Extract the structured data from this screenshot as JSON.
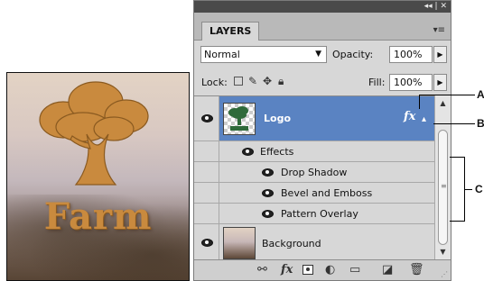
{
  "canvas_image": {
    "logo_text": "Farm"
  },
  "panel": {
    "title_controls": "◂◂ | ✕",
    "tab_label": "LAYERS",
    "tab_menu_icon": "▾≡",
    "blend_mode": "Normal",
    "opacity_label": "Opacity:",
    "opacity_value": "100%",
    "lock_label": "Lock:",
    "fill_label": "Fill:",
    "fill_value": "100%",
    "layers": [
      {
        "name": "Logo",
        "selected": true,
        "has_fx": true,
        "fx_symbol": "fx",
        "fx_arrow": "▴"
      },
      {
        "name": "Effects",
        "type": "effects-group"
      },
      {
        "name": "Drop Shadow",
        "type": "effect"
      },
      {
        "name": "Bevel and Emboss",
        "type": "effect"
      },
      {
        "name": "Pattern Overlay",
        "type": "effect"
      },
      {
        "name": "Background",
        "selected": false
      }
    ],
    "bottom_icons": [
      "link-icon",
      "fx-icon",
      "mask-icon",
      "adjustment-icon",
      "folder-icon",
      "new-layer-icon",
      "trash-icon"
    ],
    "bottom_fx_label": "fx"
  },
  "callouts": {
    "a": "A",
    "b": "B",
    "c": "C"
  },
  "colors": {
    "selection": "#5a83c2",
    "panel_bg": "#d7d7d7",
    "logo_orange": "#c98a3e"
  }
}
